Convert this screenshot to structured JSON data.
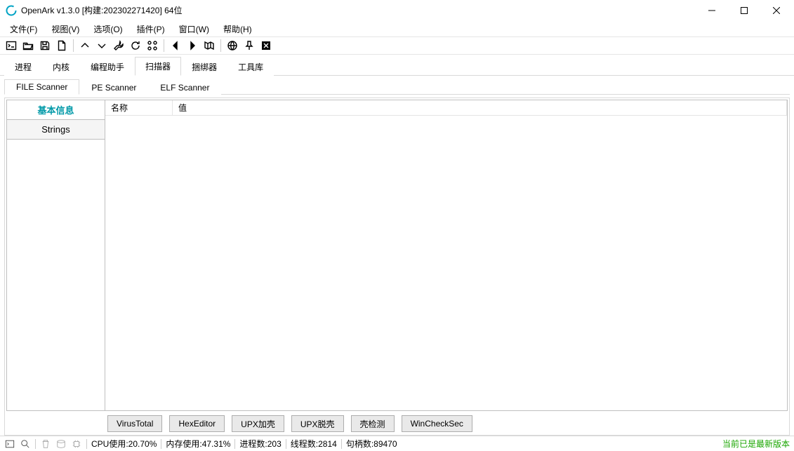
{
  "title": "OpenArk v1.3.0 [构建:202302271420]  64位",
  "menu": {
    "file": "文件(F)",
    "view": "视图(V)",
    "options": "选项(O)",
    "plugins": "插件(P)",
    "window": "窗口(W)",
    "help": "帮助(H)"
  },
  "primary_tabs": {
    "process": "进程",
    "kernel": "内核",
    "coder": "编程助手",
    "scanner": "扫描器",
    "bundler": "捆绑器",
    "utilities": "工具库"
  },
  "secondary_tabs": {
    "file": "FILE Scanner",
    "pe": "PE Scanner",
    "elf": "ELF Scanner"
  },
  "left_nav": {
    "basic": "基本信息",
    "strings": "Strings"
  },
  "columns": {
    "name": "名称",
    "value": "值"
  },
  "actions": {
    "virustotal": "VirusTotal",
    "hexeditor": "HexEditor",
    "upx_pack": "UPX加壳",
    "upx_unpack": "UPX脱壳",
    "shell_detect": "壳检测",
    "winchecksec": "WinCheckSec"
  },
  "status": {
    "cpu": "CPU使用:20.70%",
    "mem": "内存使用:47.31%",
    "processes": "进程数:203",
    "threads": "线程数:2814",
    "handles": "句柄数:89470",
    "latest": "当前已是最新版本"
  }
}
